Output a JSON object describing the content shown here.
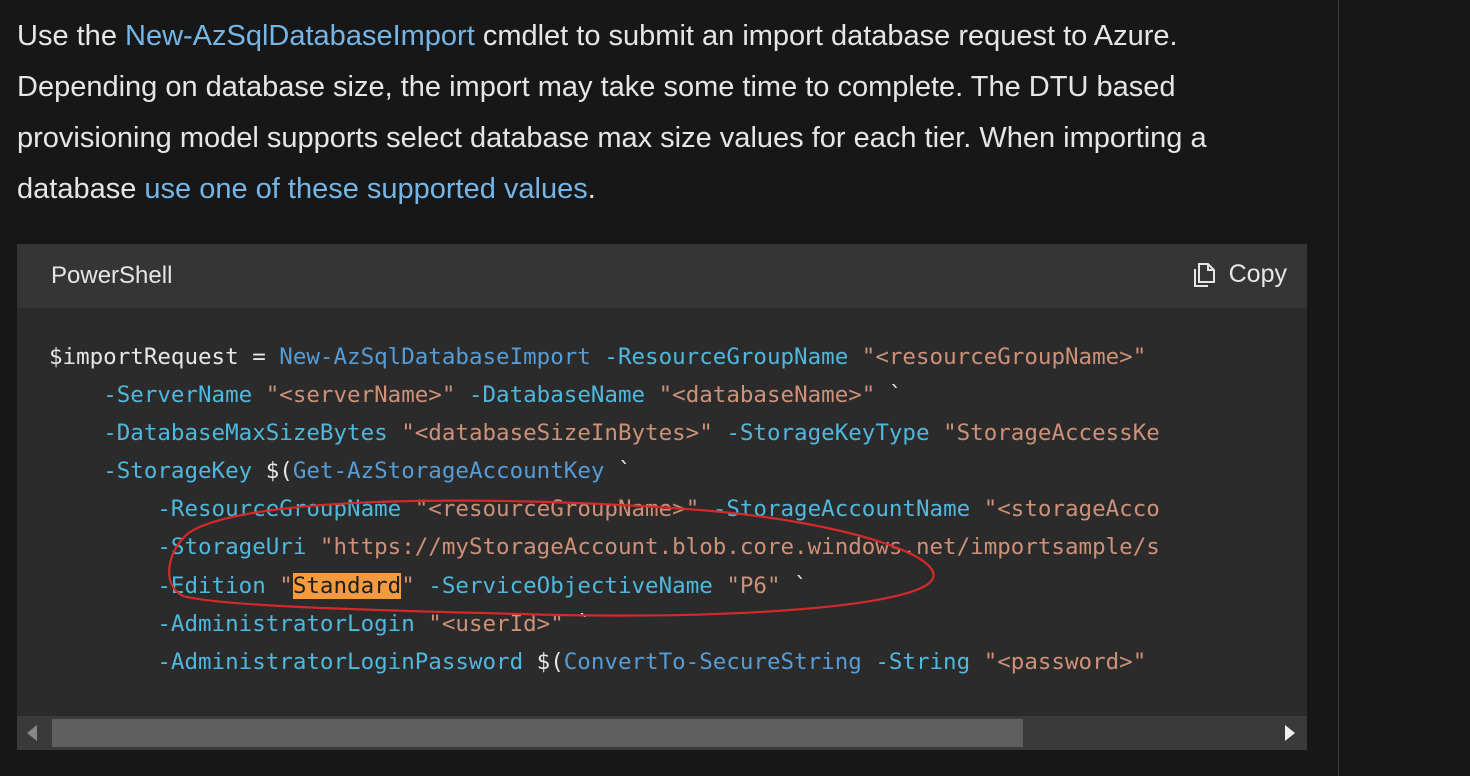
{
  "intro": {
    "part1": "Use the ",
    "link1": "New-AzSqlDatabaseImport",
    "part2": " cmdlet to submit an import database request to Azure. Depending on database size, the import may take some time to complete. The DTU based provisioning model supports select database max size values for each tier. When importing a database ",
    "link2": "use one of these supported values",
    "part3": "."
  },
  "code_block": {
    "language": "PowerShell",
    "copy_label": "Copy",
    "copy_icon": "copy-icon"
  },
  "code": {
    "l1": [
      "$importRequest = ",
      "New-AzSqlDatabaseImport",
      " -ResourceGroupName",
      " \"<resourceGroupName>\""
    ],
    "l2": [
      "    ",
      "-ServerName",
      " \"<serverName>\"",
      " -DatabaseName",
      " \"<databaseName>\"",
      " `"
    ],
    "l3": [
      "    ",
      "-DatabaseMaxSizeBytes",
      " \"<databaseSizeInBytes>\"",
      " -StorageKeyType",
      " \"StorageAccessKe"
    ],
    "l4": [
      "    ",
      "-StorageKey",
      " $(",
      "Get-AzStorageAccountKey",
      " `"
    ],
    "l5": [
      "        ",
      "-ResourceGroupName",
      " \"<resourceGroupName>\"",
      " -StorageAccountName",
      " \"<storageAcco"
    ],
    "l6": [
      "        ",
      "-StorageUri",
      " \"https://myStorageAccount.blob.core.windows.net/importsample/s"
    ],
    "l7": [
      "        ",
      "-Edition",
      " \"",
      "Standard",
      "\"",
      " -ServiceObjectiveName",
      " \"P6\"",
      " `"
    ],
    "l8": [
      "        ",
      "-AdministratorLogin",
      " \"<userId>\"",
      " `"
    ],
    "l9": [
      "        ",
      "-AdministratorLoginPassword",
      " $(",
      "ConvertTo-SecureString",
      " -String",
      " \"<password>\""
    ]
  },
  "colors": {
    "link": "#75b6e7",
    "cmdlet": "#569cd6",
    "param": "#4fb8de",
    "string": "#ce9178",
    "highlight": "#f59b3d",
    "annotation": "#d42a2a"
  }
}
